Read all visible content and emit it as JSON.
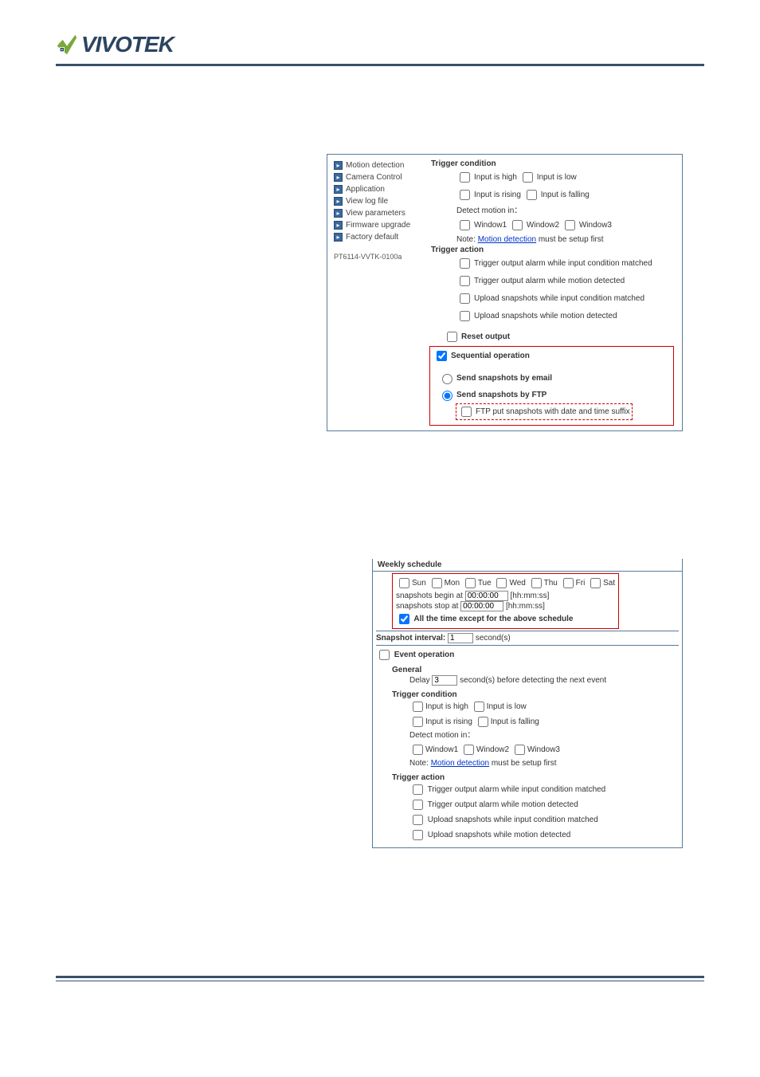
{
  "logo_text": "VIVOTEK",
  "sidebar": {
    "items": [
      "Motion detection",
      "Camera Control",
      "Application",
      "View log file",
      "View parameters",
      "Firmware upgrade",
      "Factory default"
    ],
    "device_id": "PT6114-VVTK-0100a"
  },
  "panel1": {
    "h_trigger_cond": "Trigger condition",
    "input_high": "Input is high",
    "input_low": "Input is low",
    "input_rising": "Input is rising",
    "input_falling": "Input is falling",
    "detect_motion": "Detect motion in：",
    "win1": "Window1",
    "win2": "Window2",
    "win3": "Window3",
    "note_prefix": "Note: ",
    "note_link": "Motion detection",
    "note_suffix": " must be setup first",
    "h_trigger_act": "Trigger action",
    "a1": "Trigger output alarm while input condition matched",
    "a2": "Trigger output alarm while motion detected",
    "a3": "Upload snapshots while input condition matched",
    "a4": "Upload snapshots while motion detected",
    "reset": "Reset output",
    "seq": "Sequential operation",
    "email": "Send snapshots by email",
    "ftp": "Send snapshots by FTP",
    "ftp_suffix": "FTP put snapshots with date and time suffix"
  },
  "panel2": {
    "h_weekly": "Weekly schedule",
    "days": {
      "sun": "Sun",
      "mon": "Mon",
      "tue": "Tue",
      "wed": "Wed",
      "thu": "Thu",
      "fri": "Fri",
      "sat": "Sat"
    },
    "begin_label_pre": "snapshots begin at ",
    "begin_val": "00:00:00",
    "time_unit": "[hh:mm:ss]",
    "stop_label_pre": "snapshots stop at ",
    "stop_val": "00:00:00",
    "all_time": "All the time except for the above schedule",
    "snap_int_label": "Snapshot interval:",
    "snap_int_val": "1",
    "snap_int_unit": "second(s)",
    "event_op": "Event operation",
    "general": "General",
    "delay_pre": "Delay ",
    "delay_val": "3",
    "delay_post": " second(s) before detecting the next event"
  }
}
